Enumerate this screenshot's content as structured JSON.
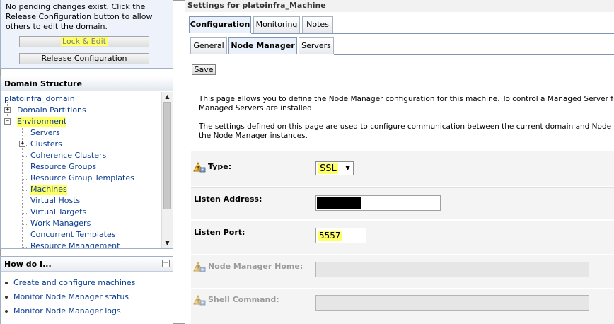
{
  "change_center": {
    "message": "No pending changes exist. Click the Release Configuration button to allow others to edit the domain.",
    "lock_edit_label": "Lock & Edit",
    "release_label": "Release Configuration"
  },
  "domain_structure": {
    "title": "Domain Structure",
    "domain": "platoinfra_domain",
    "domain_partitions": "Domain Partitions",
    "environment": "Environment",
    "servers": "Servers",
    "clusters": "Clusters",
    "coherence_clusters": "Coherence Clusters",
    "resource_groups": "Resource Groups",
    "resource_group_templates": "Resource Group Templates",
    "machines": "Machines",
    "virtual_hosts": "Virtual Hosts",
    "virtual_targets": "Virtual Targets",
    "work_managers": "Work Managers",
    "concurrent_templates": "Concurrent Templates",
    "resource_management": "Resource Management"
  },
  "how_do_i": {
    "title": "How do I...",
    "items": [
      "Create and configure machines",
      "Monitor Node Manager status",
      "Monitor Node Manager logs"
    ]
  },
  "settings": {
    "title": "Settings for platoinfra_Machine",
    "tabs": [
      "Configuration",
      "Monitoring",
      "Notes"
    ],
    "subtabs": [
      "General",
      "Node Manager",
      "Servers"
    ],
    "save_label": "Save",
    "desc1_line1": "This page allows you to define the Node Manager configuration for this machine. To control a Managed Server from th",
    "desc1_line2": "Managed Servers are installed.",
    "desc2_line1": "The settings defined on this page are used to configure communication between the current domain and Node Manag",
    "desc2_line2": "the Node Manager instances.",
    "type_label": "Type:",
    "type_value": "SSL",
    "listen_address_label": "Listen Address:",
    "listen_port_label": "Listen Port:",
    "listen_port_value": "5557",
    "nm_home_label": "Node Manager Home:",
    "shell_command_label": "Shell Command:"
  },
  "colors": {
    "highlight": "#ffff66",
    "link": "#0b3d91",
    "panel_border": "#9eb1c8"
  }
}
